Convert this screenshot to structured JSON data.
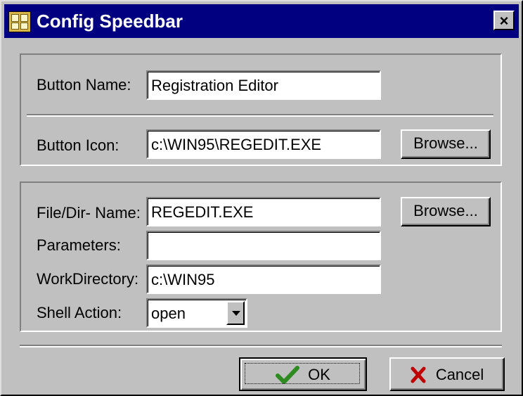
{
  "window": {
    "title": "Config Speedbar",
    "close_label": "×"
  },
  "button_group": {
    "name_label": "Button Name:",
    "name_value": "Registration Editor",
    "icon_label": "Button Icon:",
    "icon_value": "c:\\WIN95\\REGEDIT.EXE",
    "browse_label": "Browse..."
  },
  "file_group": {
    "file_label": "File/Dir- Name:",
    "file_value": "REGEDIT.EXE",
    "browse_label": "Browse...",
    "params_label": "Parameters:",
    "params_value": "",
    "workdir_label": "WorkDirectory:",
    "workdir_value": "c:\\WIN95",
    "shell_label": "Shell Action:",
    "shell_value": "open"
  },
  "footer": {
    "ok_label": "OK",
    "cancel_label": "Cancel"
  },
  "colors": {
    "title_bar": "#000080",
    "face": "#c0c0c0",
    "ok_check": "#2e8b22",
    "cancel_x": "#c00000"
  }
}
